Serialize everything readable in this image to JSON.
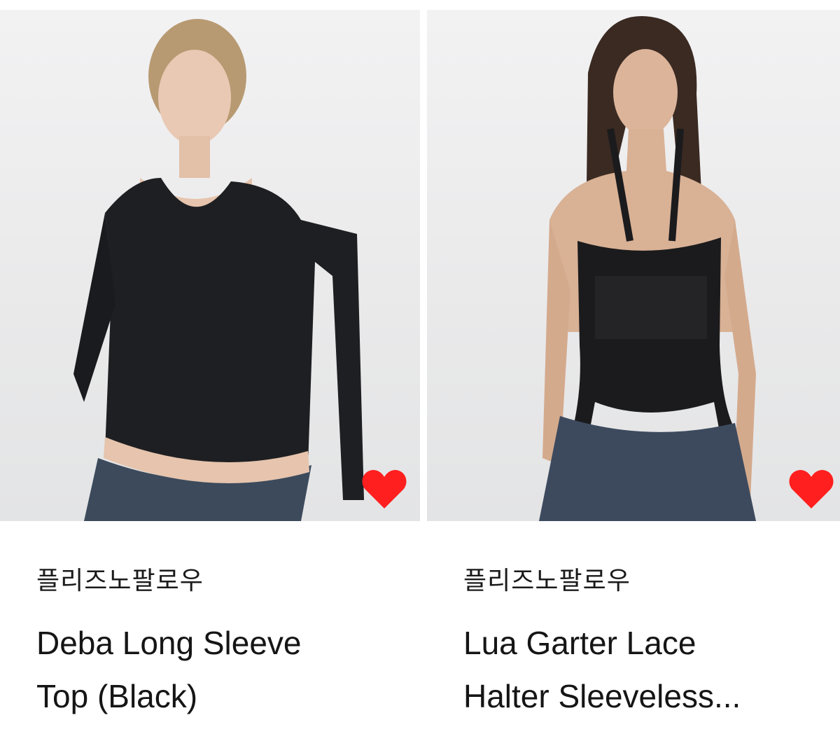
{
  "products": [
    {
      "brand": "플리즈노팔로우",
      "title_line1": "Deba Long Sleeve",
      "title_line2": "Top (Black)",
      "favorited": true
    },
    {
      "brand": "플리즈노팔로우",
      "title_line1": "Lua Garter Lace",
      "title_line2": "Halter Sleeveless...",
      "favorited": true
    }
  ],
  "colors": {
    "heart": "#ff1f1f",
    "image_bg": "#ececed",
    "text": "#151515"
  },
  "icons": {
    "favorite": "heart-icon"
  }
}
